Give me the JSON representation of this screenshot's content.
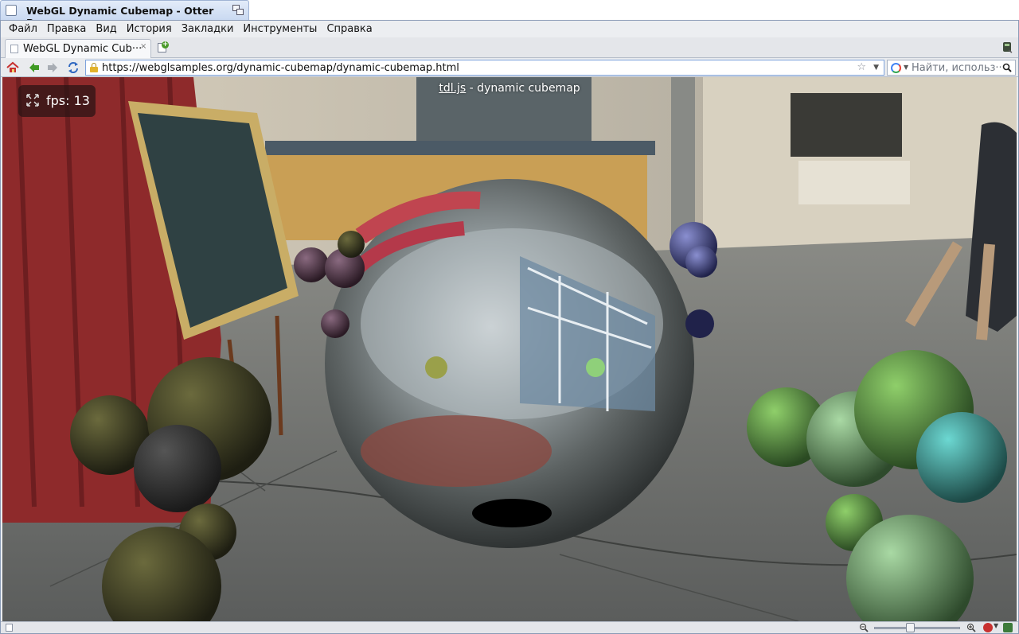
{
  "window": {
    "title": "WebGL Dynamic Cubemap - Otter Browser"
  },
  "menu": [
    "Файл",
    "Правка",
    "Вид",
    "История",
    "Закладки",
    "Инструменты",
    "Справка"
  ],
  "tabs": [
    {
      "label": "WebGL Dynamic Cub···",
      "close": "×"
    }
  ],
  "address": {
    "url": "https://webglsamples.org/dynamic-cubemap/dynamic-cubemap.html"
  },
  "search": {
    "placeholder": "Найти, использ···"
  },
  "page": {
    "title_link": "tdl.js",
    "title_rest": " - dynamic cubemap",
    "fps": "fps: 13"
  },
  "icons": {
    "home": "home-icon",
    "back": "back-arrow-icon",
    "forward": "forward-arrow-icon",
    "reload": "reload-icon",
    "lock": "lock-icon",
    "bookmark": "star-icon",
    "search_engine": "google-icon",
    "magnifier": "search-icon",
    "fullscreen": "fullscreen-icon"
  },
  "colors": {
    "url_border": "#7ea3dc",
    "title_tab": "#c9d9f1",
    "back_arrow": "#3f9a24",
    "home": "#c8302f"
  }
}
